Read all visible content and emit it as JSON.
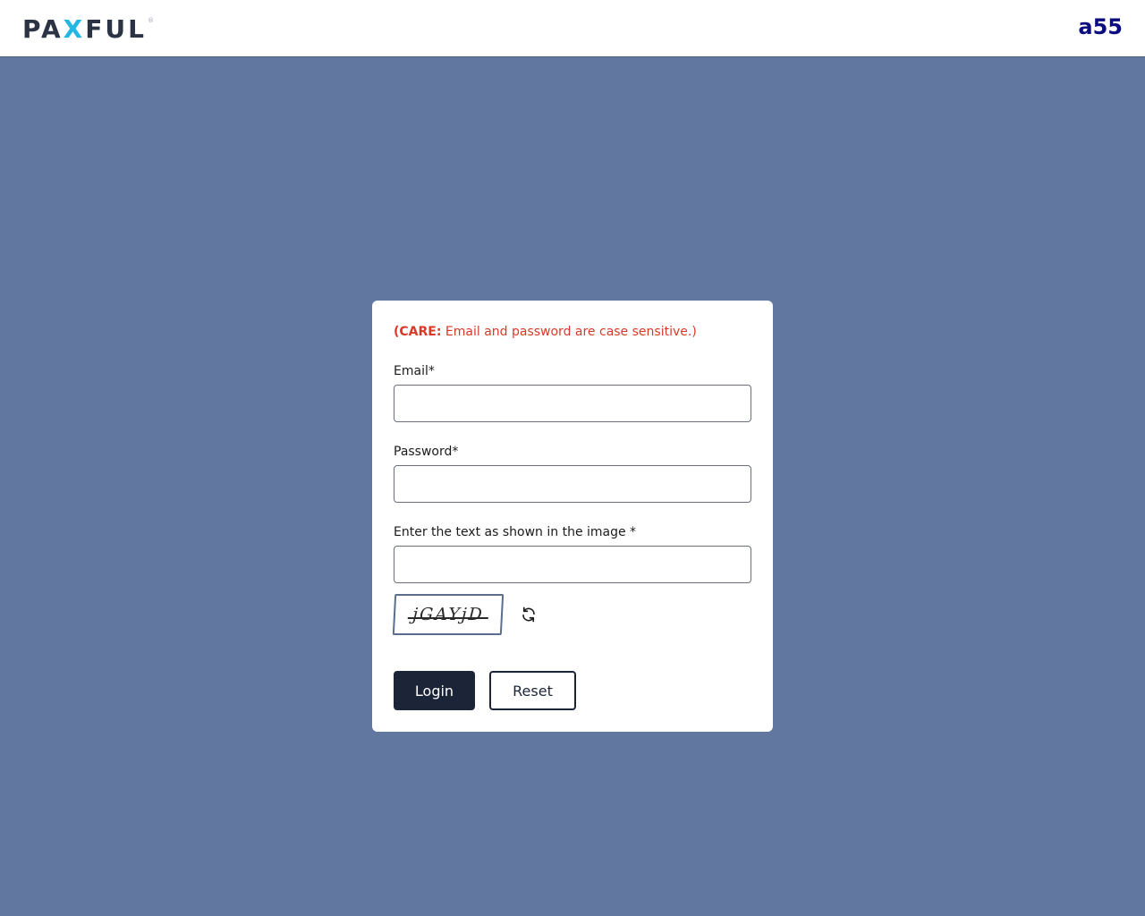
{
  "header": {
    "logo_pre": "PA",
    "logo_x": "X",
    "logo_post": "FUL",
    "logo_reg": "®",
    "user_code": "a55"
  },
  "login": {
    "care_bold": "(CARE:",
    "care_text": " Email and password are case sensitive.)",
    "email_label": "Email*",
    "email_value": "",
    "password_label": "Password*",
    "password_value": "",
    "captcha_label": "Enter the text as shown in the image *",
    "captcha_value": "",
    "captcha_text": "jGAYjD",
    "login_label": "Login",
    "reset_label": "Reset"
  },
  "colors": {
    "background": "#6177a0",
    "care": "#d83a2a",
    "primary_button": "#1c2538",
    "user_code": "#0b0c7d"
  }
}
